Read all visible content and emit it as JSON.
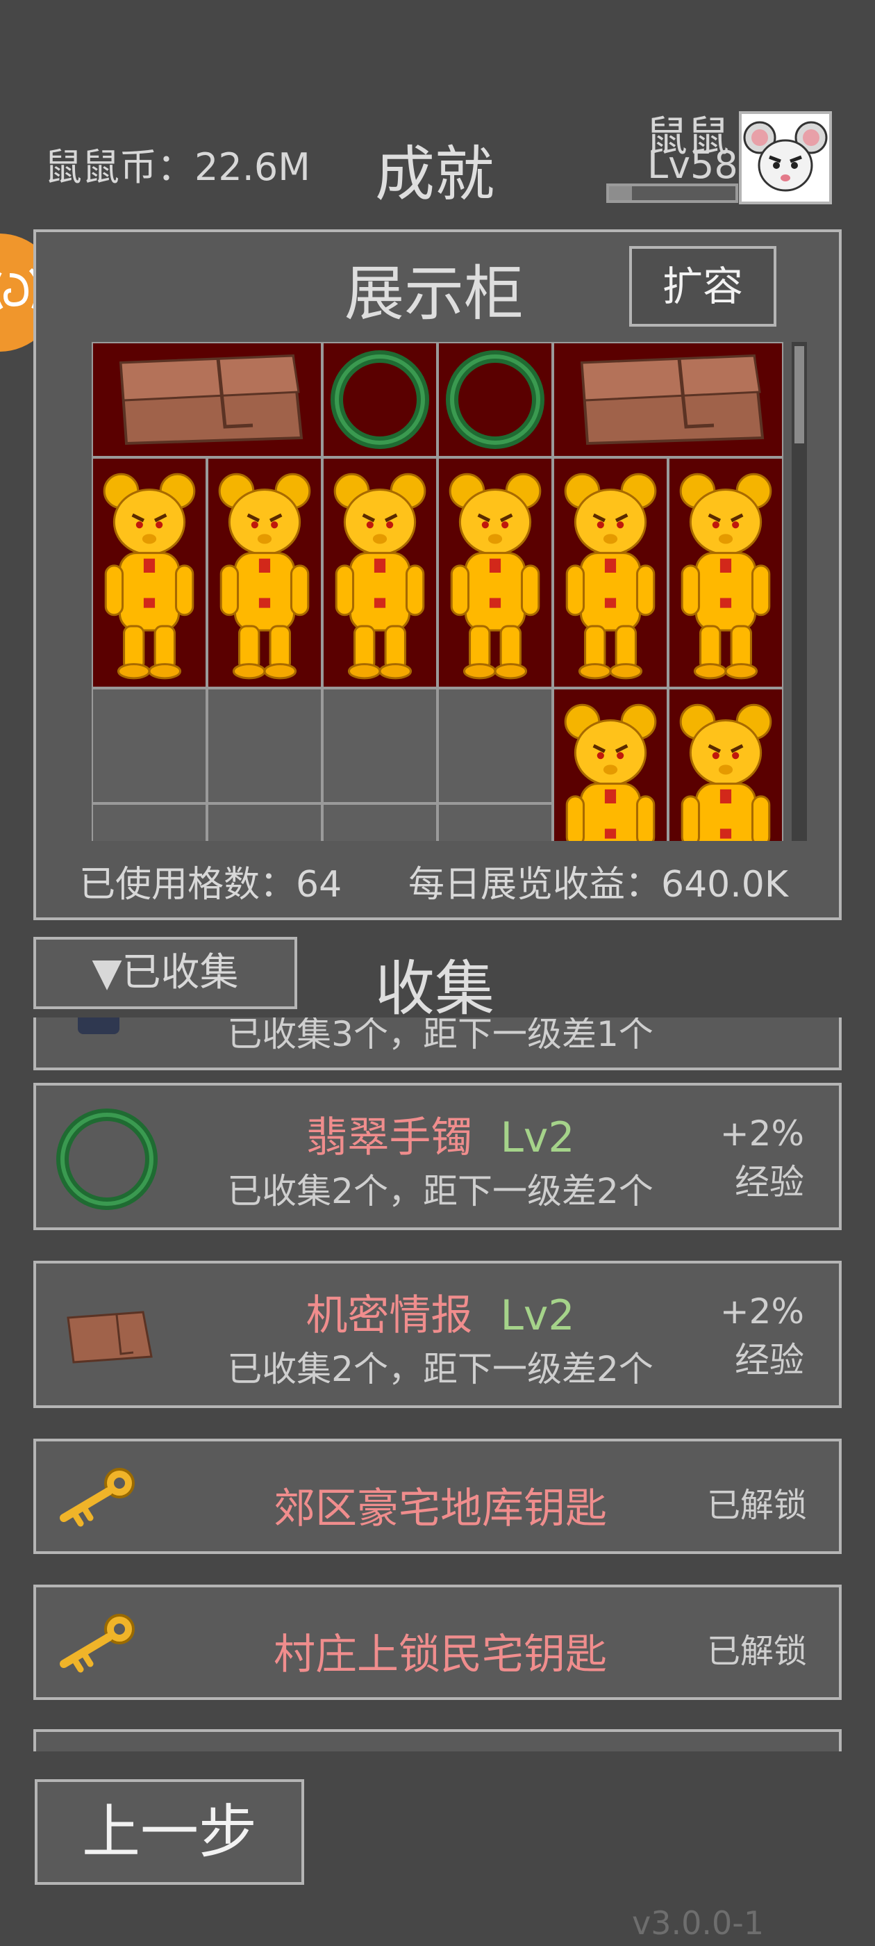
{
  "header": {
    "coins": "鼠鼠币：22.6M",
    "title": "成就",
    "user_name": "鼠鼠",
    "user_level": "Lv58",
    "xp_progress": 0.18
  },
  "showcase": {
    "title": "展示柜",
    "expand_label": "扩容",
    "used_cells": "已使用格数：64",
    "daily_income": "每日展览收益：640.0K"
  },
  "collection": {
    "filter_label": "▼已收集",
    "title": "收集",
    "partial_top_text": "已收集3个，距下一级差1个",
    "items": [
      {
        "name": "翡翠手镯",
        "level": "Lv2",
        "desc": "已收集2个，距下一级差2个",
        "bonus_value": "+2%",
        "bonus_type": "经验",
        "icon": "jade-bracelet-icon"
      },
      {
        "name": "机密情报",
        "level": "Lv2",
        "desc": "已收集2个，距下一级差2个",
        "bonus_value": "+2%",
        "bonus_type": "经验",
        "icon": "folder-icon"
      },
      {
        "name": "郊区豪宅地库钥匙",
        "status": "已解锁",
        "icon": "golden-key-icon"
      },
      {
        "name": "村庄上锁民宅钥匙",
        "status": "已解锁",
        "icon": "golden-key-icon"
      }
    ]
  },
  "footer": {
    "back_label": "上一步",
    "version": "v3.0.0-1"
  },
  "colors": {
    "background": "#474747",
    "panel": "#595959",
    "border": "#b5b5b5",
    "filled_cell": "#5a0000",
    "item_name": "#f08d8d",
    "level_green": "#a5d38a",
    "badge_orange": "#f0962c"
  }
}
